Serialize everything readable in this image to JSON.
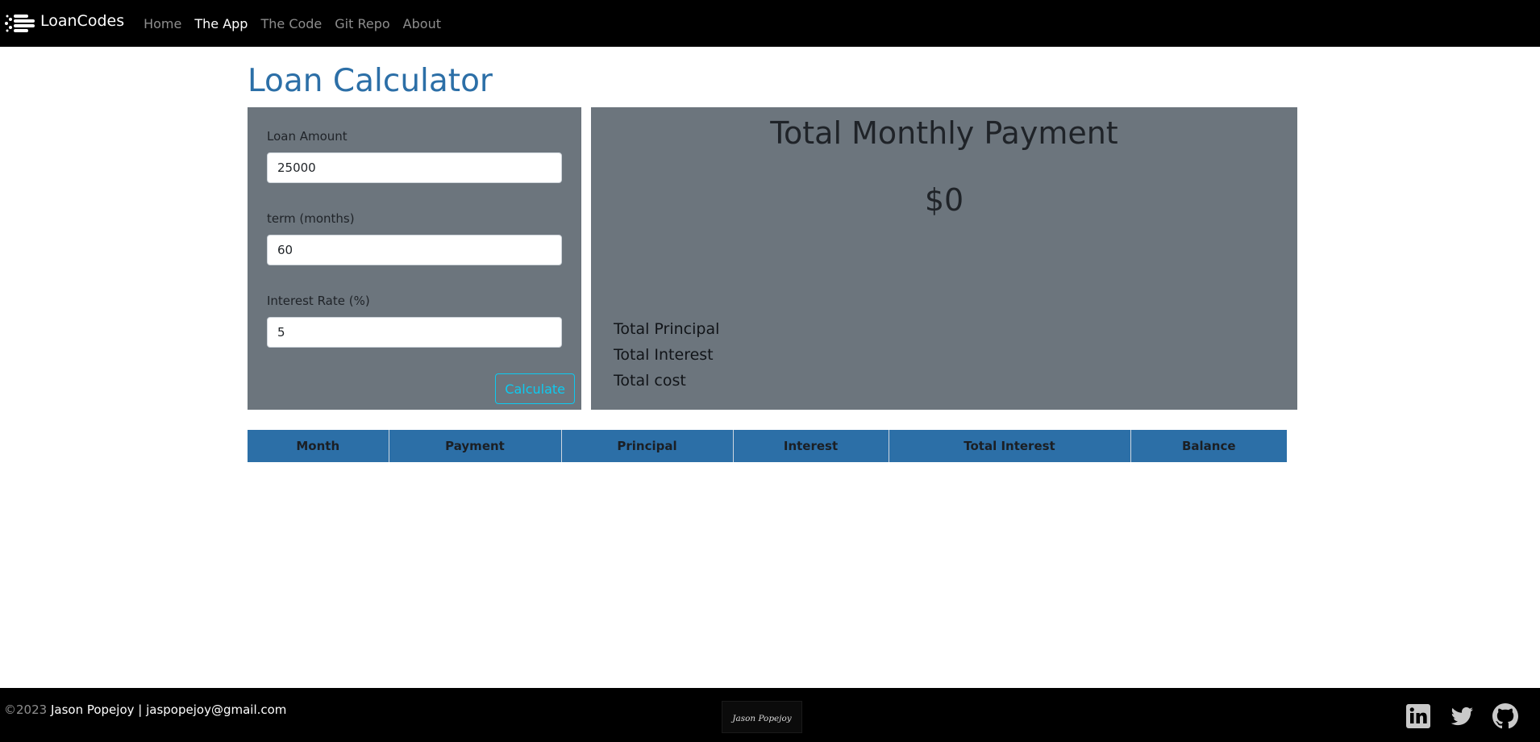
{
  "nav": {
    "brand": "LoanCodes",
    "links": [
      {
        "label": "Home"
      },
      {
        "label": "The App"
      },
      {
        "label": "The Code"
      },
      {
        "label": "Git Repo"
      },
      {
        "label": "About"
      }
    ]
  },
  "page": {
    "title": "Loan Calculator"
  },
  "form": {
    "loan_amount": {
      "label": "Loan Amount",
      "value": "25000"
    },
    "term": {
      "label": "term (months)",
      "value": "60"
    },
    "rate": {
      "label": "Interest Rate (%)",
      "value": "5"
    },
    "calculate_label": "Calculate"
  },
  "results": {
    "title": "Total Monthly Payment",
    "monthly_payment": "$0",
    "total_principal_label": "Total Principal",
    "total_interest_label": "Total Interest",
    "total_cost_label": "Total cost"
  },
  "table": {
    "headers": [
      "Month",
      "Payment",
      "Principal",
      "Interest",
      "Total Interest",
      "Balance"
    ]
  },
  "footer": {
    "copyright": "©2023",
    "author": "Jason Popejoy | jaspopejoy@gmail.com",
    "signature": "Jason Popejoy"
  },
  "colors": {
    "accent": "#2c6fa7",
    "panel": "#6c757d",
    "button": "#0dcaf0"
  },
  "icons": [
    "linkedin-icon",
    "twitter-icon",
    "github-icon"
  ]
}
